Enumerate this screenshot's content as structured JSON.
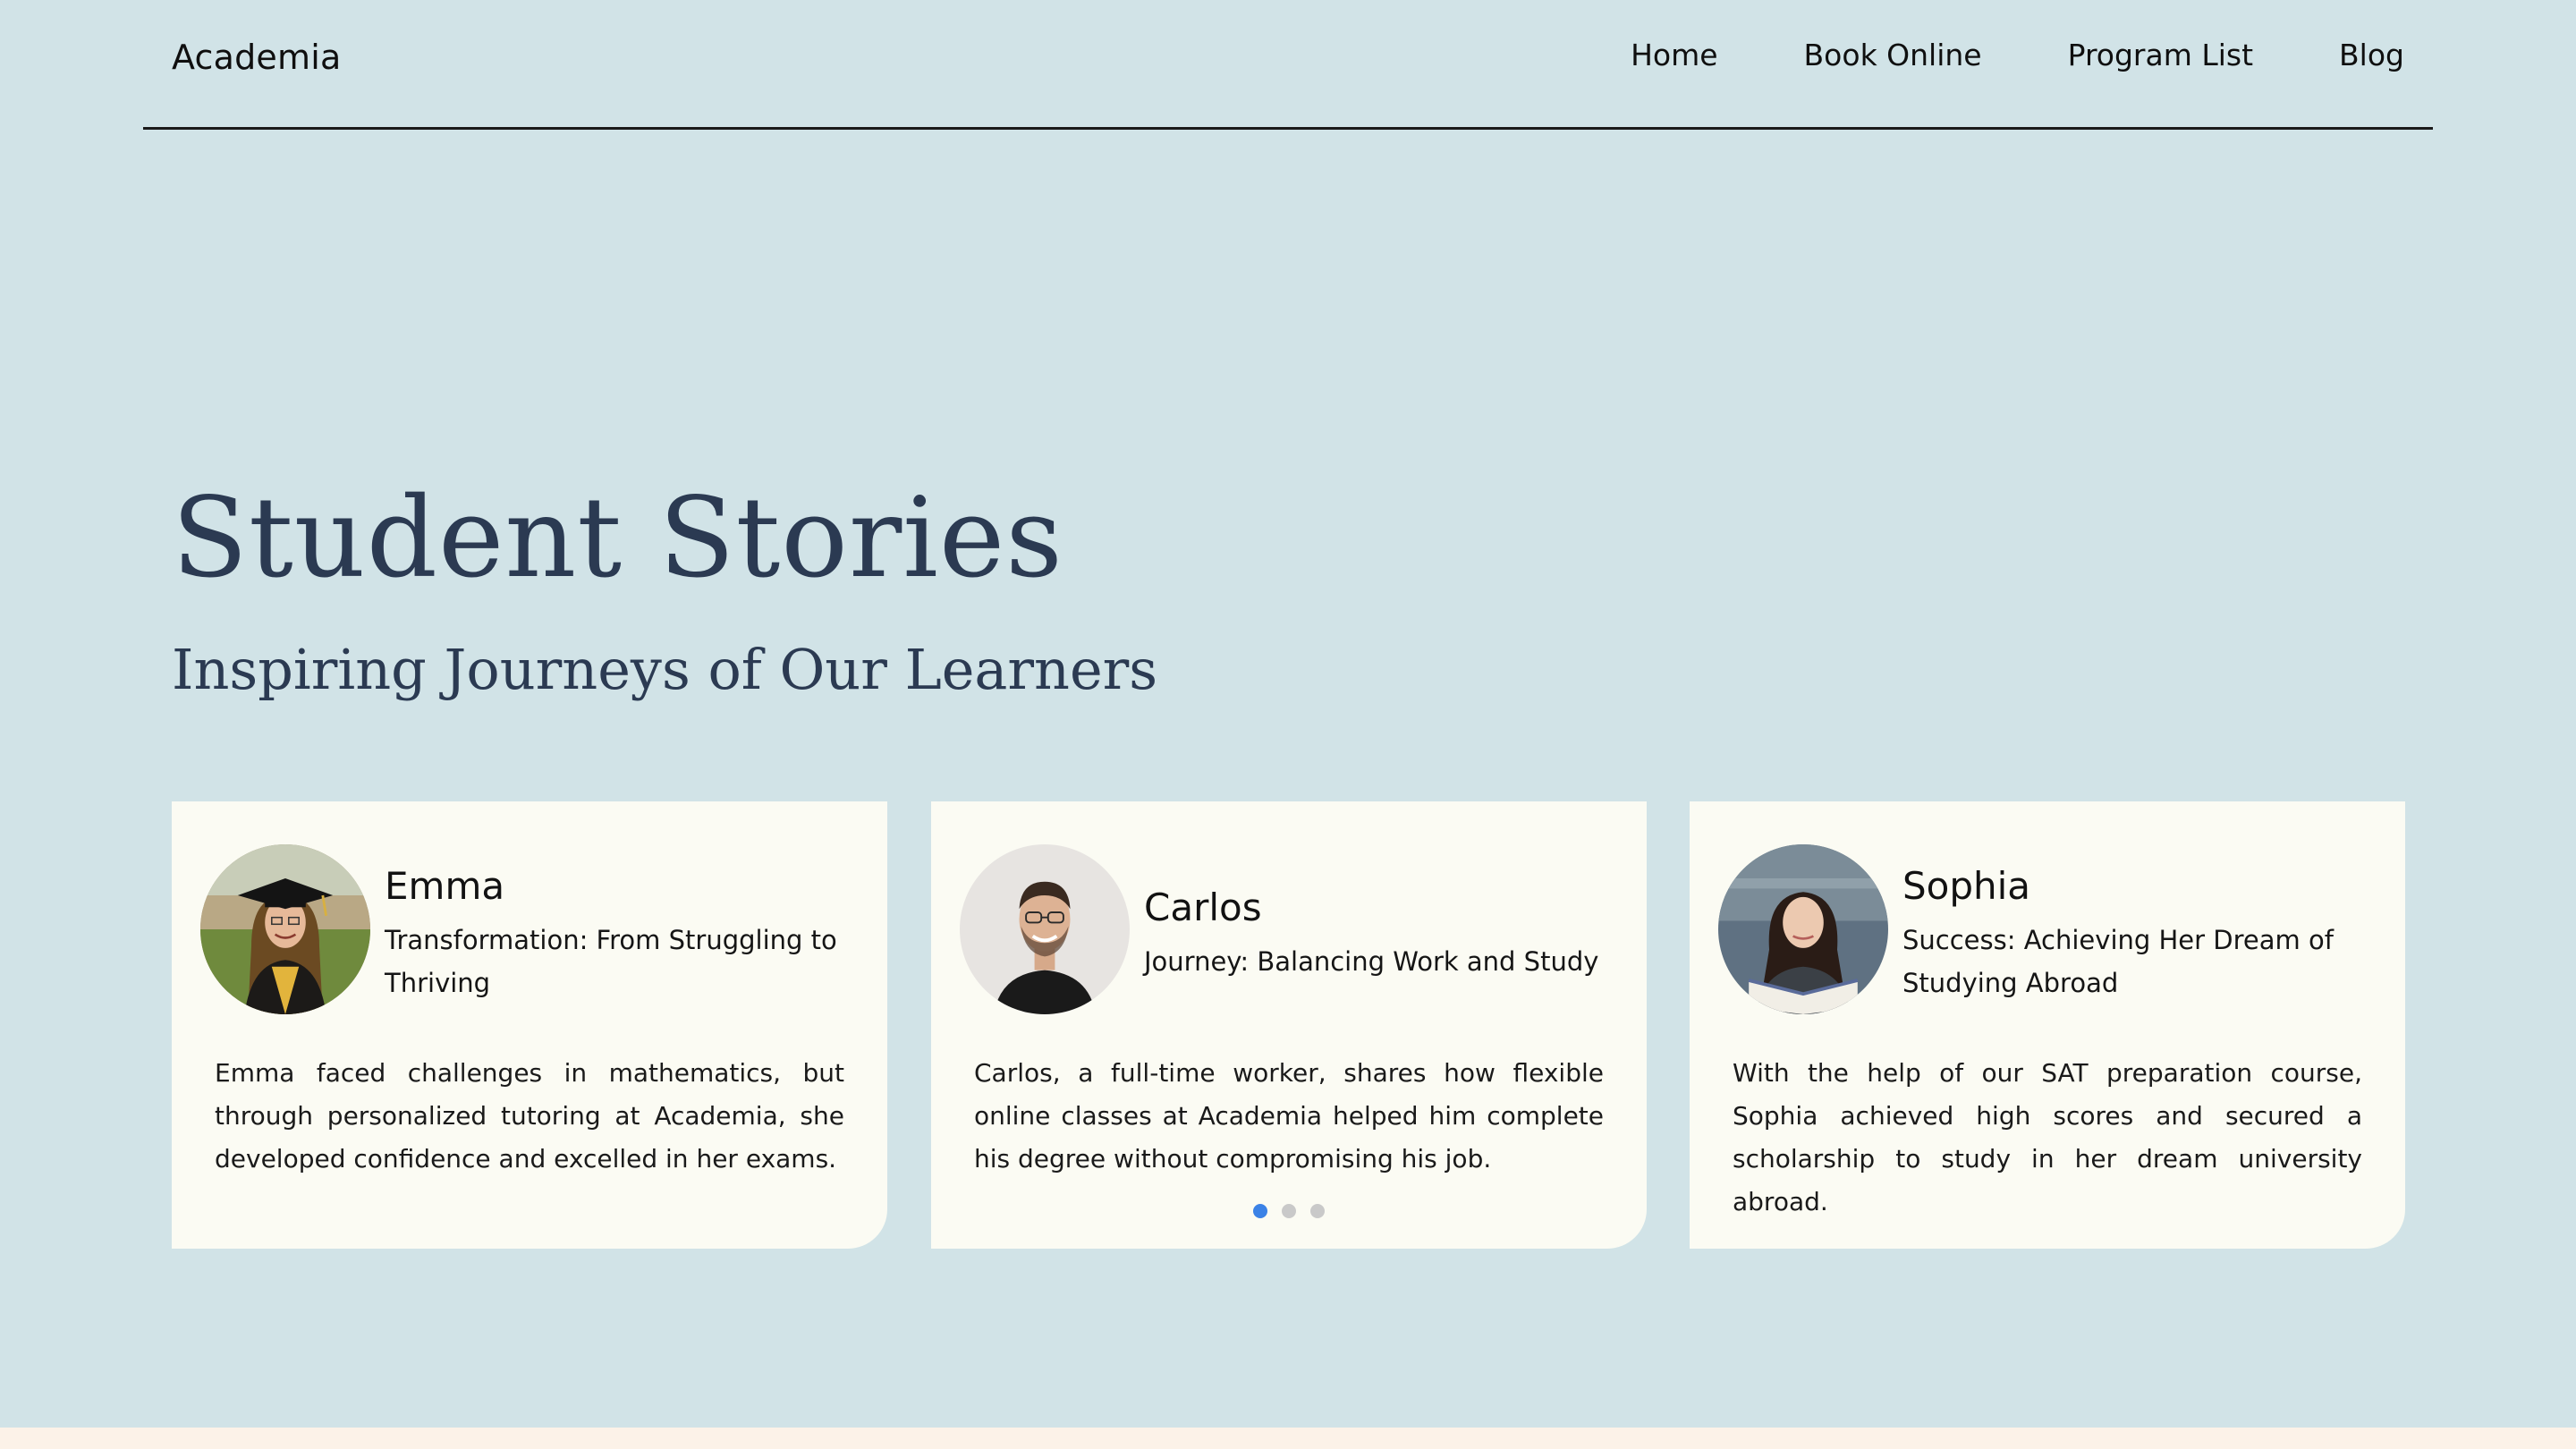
{
  "header": {
    "logo": "Academia",
    "nav": [
      "Home",
      "Book Online",
      "Program List",
      "Blog"
    ]
  },
  "hero": {
    "title": "Student Stories",
    "subtitle": "Inspiring Journeys of Our Learners"
  },
  "cards": [
    {
      "name": "Emma",
      "tagline": "Transformation: From Struggling to Thriving",
      "body": "Emma faced challenges in mathematics, but through personalized tutoring at Academia, she developed confidence and excelled in her exams.",
      "avatar": "graduate-woman-photo"
    },
    {
      "name": "Carlos",
      "tagline": "Journey: Balancing Work and Study",
      "body": "Carlos, a full-time worker, shares how flexible online classes at Academia helped him complete his degree without compromising his job.",
      "avatar": "smiling-man-photo"
    },
    {
      "name": "Sophia",
      "tagline": "Success: Achieving Her Dream of Studying Abroad",
      "body": "With the help of our SAT preparation course, Sophia achieved high scores and secured a scholarship to study in her dream university abroad.",
      "avatar": "woman-reading-book-photo"
    }
  ],
  "carousel": {
    "dot_count": 3,
    "active_index": 0,
    "active_color": "#3b82e6"
  },
  "colors": {
    "background": "#d1e3e7",
    "card": "#fbfbf3",
    "heading": "#2b3a52",
    "footer": "#fcf2e8"
  }
}
